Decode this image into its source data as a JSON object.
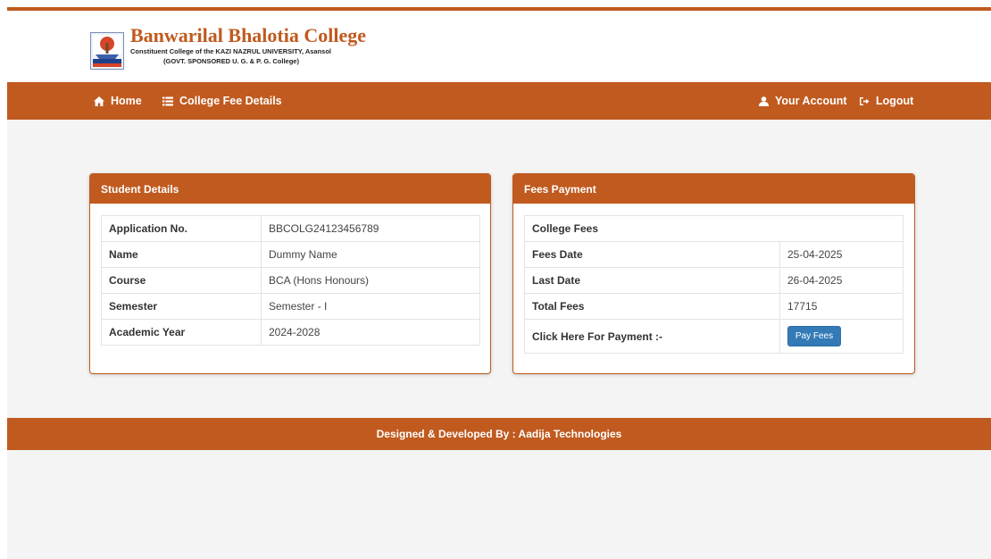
{
  "header": {
    "college_name": "Banwarilal Bhalotia College",
    "subtitle_line1": "Constituent College of the KAZI NAZRUL UNIVERSITY, Asansol",
    "subtitle_line2": "(GOVT. SPONSORED U. G. & P. G. College)",
    "logo_icon": "college-crest-icon"
  },
  "navbar": {
    "home_label": "Home",
    "fee_details_label": "College Fee Details",
    "account_label": "Your Account",
    "logout_label": "Logout"
  },
  "student_details": {
    "title": "Student Details",
    "rows": [
      {
        "label": "Application No.",
        "value": "BBCOLG24123456789"
      },
      {
        "label": "Name",
        "value": "Dummy Name"
      },
      {
        "label": "Course",
        "value": "BCA (Hons Honours)"
      },
      {
        "label": "Semester",
        "value": "Semester - I"
      },
      {
        "label": "Academic Year",
        "value": "2024-2028"
      }
    ]
  },
  "fees_payment": {
    "title": "Fees Payment",
    "section_label": "College Fees",
    "rows": [
      {
        "label": "Fees Date",
        "value": "25-04-2025"
      },
      {
        "label": "Last Date",
        "value": "26-04-2025"
      },
      {
        "label": "Total Fees",
        "value": "17715"
      }
    ],
    "payment_prompt": "Click Here For Payment :-",
    "pay_button_label": "Pay Fees"
  },
  "footer": {
    "text": "Designed & Developed By : Aadija Technologies"
  },
  "colors": {
    "brand": "#c05a1f",
    "button": "#337ab7",
    "background": "#f4f4f4"
  }
}
